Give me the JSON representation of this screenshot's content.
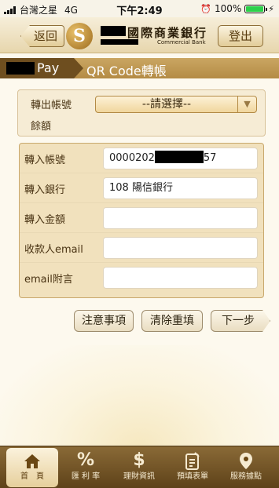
{
  "status_bar": {
    "carrier": "台灣之星",
    "network": "4G",
    "time": "下午2:49",
    "battery": "100%"
  },
  "header": {
    "back_label": "返回",
    "bank_name": "國際商業銀行",
    "bank_name_en": "Commercial Bank",
    "logout_label": "登出"
  },
  "title_bar": {
    "pay_label": "Pay",
    "title": "QR Code轉帳"
  },
  "source_account": {
    "account_label": "轉出帳號",
    "select_value": "--請選擇--",
    "balance_label": "餘額"
  },
  "form": {
    "rows": [
      {
        "label": "轉入帳號",
        "value_prefix": "0000202",
        "value_suffix": "57"
      },
      {
        "label": "轉入銀行",
        "value": "108 陽信銀行"
      },
      {
        "label": "轉入金額",
        "value": ""
      },
      {
        "label": "收款人email",
        "value": ""
      },
      {
        "label": "email附言",
        "value": ""
      }
    ]
  },
  "actions": {
    "notice": "注意事項",
    "clear": "清除重填",
    "next": "下一步"
  },
  "bottom_nav": [
    {
      "label": "首　頁",
      "icon": "home-icon"
    },
    {
      "label": "匯 利 率",
      "icon": "percent-icon"
    },
    {
      "label": "理財資訊",
      "icon": "finance-icon"
    },
    {
      "label": "預填表單",
      "icon": "form-icon"
    },
    {
      "label": "服務據點",
      "icon": "location-icon"
    }
  ]
}
